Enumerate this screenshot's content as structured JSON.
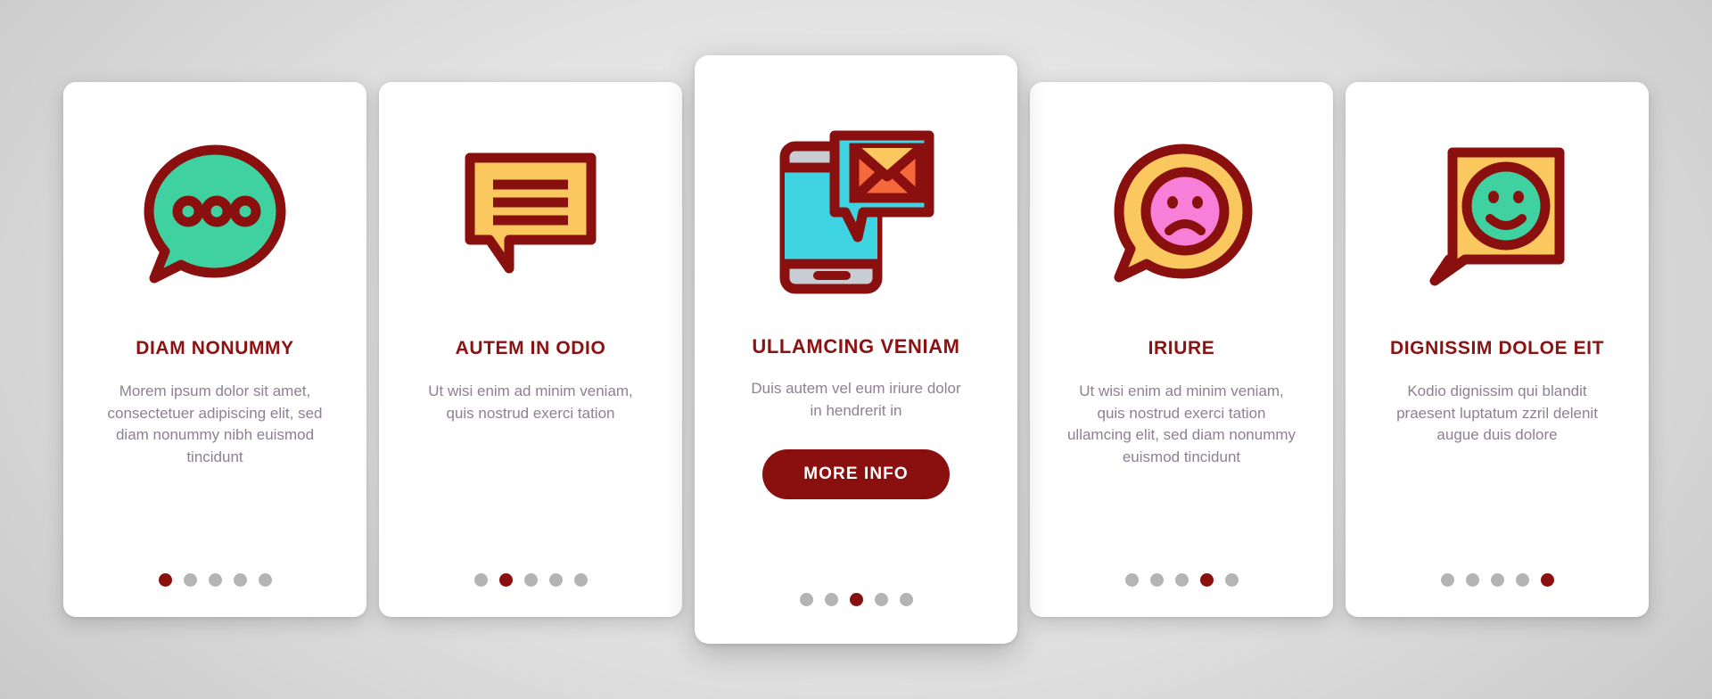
{
  "theme": {
    "accent": "#8A1010",
    "dot_inactive": "#b4b4b4",
    "body_text": "#8e7f92",
    "card_bg": "#ffffff",
    "icon_green": "#3FD1A0",
    "icon_yellow": "#FBC85F",
    "icon_cyan": "#3DD3E0",
    "icon_orange": "#F4683C",
    "icon_pink": "#F77FD8",
    "icon_outline": "#8A1010",
    "icon_gray": "#C8CDD4"
  },
  "cards": [
    {
      "icon_name": "speech-bubble-dots-icon",
      "title": "DIAM NONUMMY",
      "description": "Morem ipsum dolor sit amet, consectetuer adipiscing elit, sed diam nonummy nibh euismod tincidunt",
      "dots": 5,
      "active_dot": 1,
      "featured": false
    },
    {
      "icon_name": "speech-bubble-lines-icon",
      "title": "AUTEM IN ODIO",
      "description": "Ut wisi enim ad minim veniam, quis nostrud exerci tation",
      "dots": 5,
      "active_dot": 2,
      "featured": false
    },
    {
      "icon_name": "phone-message-envelope-icon",
      "title": "ULLAMCING VENIAM",
      "description": "Duis autem vel eum iriure dolor in hendrerit in",
      "button_label": "MORE INFO",
      "dots": 5,
      "active_dot": 3,
      "featured": true
    },
    {
      "icon_name": "sad-face-bubble-icon",
      "title": "IRIURE",
      "description": "Ut wisi enim ad minim veniam, quis nostrud exerci tation ullamcing elit, sed diam nonummy euismod tincidunt",
      "dots": 5,
      "active_dot": 4,
      "featured": false
    },
    {
      "icon_name": "happy-face-bubble-icon",
      "title": "DIGNISSIM DOLOE EIT",
      "description": "Kodio dignissim qui blandit praesent luptatum zzril delenit augue duis dolore",
      "dots": 5,
      "active_dot": 5,
      "featured": false
    }
  ]
}
